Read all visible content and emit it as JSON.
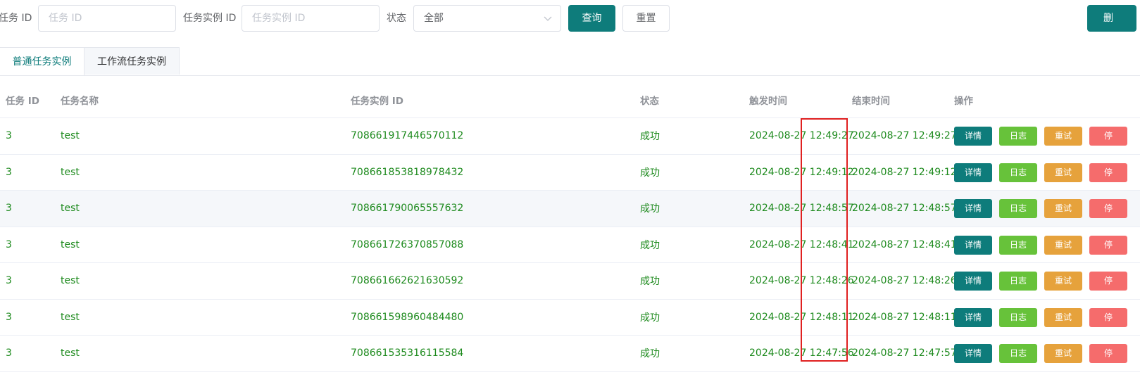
{
  "search": {
    "task_id_label": "任务 ID",
    "task_id_placeholder": "任务 ID",
    "task_id_value": "",
    "instance_id_label": "任务实例 ID",
    "instance_id_placeholder": "任务实例 ID",
    "instance_id_value": "",
    "status_label": "状态",
    "status_value": "全部",
    "query_button": "查询",
    "reset_button": "重置",
    "right_button": "删"
  },
  "tabs": [
    {
      "label": "普通任务实例",
      "active": true
    },
    {
      "label": "工作流任务实例",
      "active": false
    }
  ],
  "table": {
    "headers": [
      "任务 ID",
      "任务名称",
      "任务实例 ID",
      "状态",
      "触发时间",
      "结束时间",
      "操作"
    ],
    "action_labels": {
      "detail": "详情",
      "log": "日志",
      "retry": "重试",
      "stop": "停"
    },
    "rows": [
      {
        "id": "3",
        "name": "test",
        "instance_id": "708661917446570112",
        "status": "成功",
        "trigger_time": "2024-08-27 12:49:27",
        "end_time": "2024-08-27 12:49:27"
      },
      {
        "id": "3",
        "name": "test",
        "instance_id": "708661853818978432",
        "status": "成功",
        "trigger_time": "2024-08-27 12:49:12",
        "end_time": "2024-08-27 12:49:12"
      },
      {
        "id": "3",
        "name": "test",
        "instance_id": "708661790065557632",
        "status": "成功",
        "trigger_time": "2024-08-27 12:48:57",
        "end_time": "2024-08-27 12:48:57"
      },
      {
        "id": "3",
        "name": "test",
        "instance_id": "708661726370857088",
        "status": "成功",
        "trigger_time": "2024-08-27 12:48:41",
        "end_time": "2024-08-27 12:48:41"
      },
      {
        "id": "3",
        "name": "test",
        "instance_id": "708661662621630592",
        "status": "成功",
        "trigger_time": "2024-08-27 12:48:26",
        "end_time": "2024-08-27 12:48:26"
      },
      {
        "id": "3",
        "name": "test",
        "instance_id": "708661598960484480",
        "status": "成功",
        "trigger_time": "2024-08-27 12:48:11",
        "end_time": "2024-08-27 12:48:11"
      },
      {
        "id": "3",
        "name": "test",
        "instance_id": "708661535316115584",
        "status": "成功",
        "trigger_time": "2024-08-27 12:47:56",
        "end_time": "2024-08-27 12:47:57"
      }
    ]
  },
  "colors": {
    "primary": "#0e7c7b",
    "success_text": "#1d8a1d",
    "log_button": "#67c23a",
    "retry_button": "#e6a23c",
    "stop_button": "#f56c6c",
    "highlight_box": "#e02020"
  }
}
